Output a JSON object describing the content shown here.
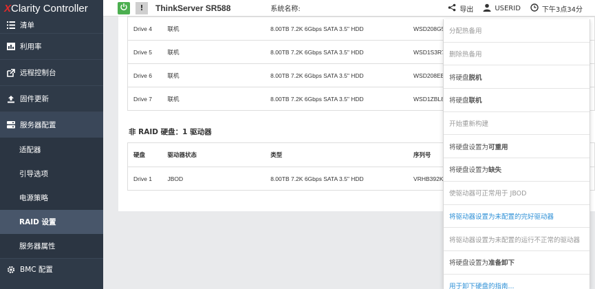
{
  "app": {
    "brand_x": "X",
    "brand_rest": "Clarity",
    "brand_suffix": " Controller"
  },
  "header": {
    "warn_symbol": "!",
    "server_name": "ThinkServer SR588",
    "system_name_label": "系统名称:",
    "export_label": "导出",
    "user_label": "USERID",
    "time_label": "下午3点34分",
    "colors": {
      "power": "#4caf50"
    }
  },
  "sidebar": {
    "items": [
      {
        "label": "清单",
        "icon": "list-icon"
      },
      {
        "label": "利用率",
        "icon": "bar-chart-icon"
      },
      {
        "label": "远程控制台",
        "icon": "external-link-icon"
      },
      {
        "label": "固件更新",
        "icon": "upload-icon"
      },
      {
        "label": "服务器配置",
        "icon": "server-icon"
      }
    ],
    "sub_items": [
      {
        "label": "适配器"
      },
      {
        "label": "引导选项"
      },
      {
        "label": "电源策略"
      },
      {
        "label": "RAID 设置"
      },
      {
        "label": "服务器属性"
      }
    ],
    "bottom_item": {
      "label": "BMC 配置",
      "icon": "gear-icon"
    }
  },
  "raid_table": {
    "rows": [
      {
        "drive": "Drive 4",
        "state": "联机",
        "type": "8.00TB 7.2K 6Gbps SATA 3.5\" HDD",
        "serial": "WSD208G5"
      },
      {
        "drive": "Drive 5",
        "state": "联机",
        "type": "8.00TB 7.2K 6Gbps SATA 3.5\" HDD",
        "serial": "WSD1S3R7"
      },
      {
        "drive": "Drive 6",
        "state": "联机",
        "type": "8.00TB 7.2K 6Gbps SATA 3.5\" HDD",
        "serial": "WSD208EB"
      },
      {
        "drive": "Drive 7",
        "state": "联机",
        "type": "8.00TB 7.2K 6Gbps SATA 3.5\" HDD",
        "serial": "WSD1ZBL8"
      }
    ]
  },
  "non_raid": {
    "title": "非 RAID 硬盘：1 驱动器",
    "headers": {
      "drive": "硬盘",
      "state": "驱动器状态",
      "type": "类型",
      "serial": "序列号"
    },
    "rows": [
      {
        "drive": "Drive 1",
        "state": "JBOD",
        "type": "8.00TB 7.2K 6Gbps SATA 3.5\" HDD",
        "serial": "VRHB392K"
      }
    ]
  },
  "menu": {
    "items": [
      {
        "label": "分配热备用",
        "state": "disabled"
      },
      {
        "label": "删除热备用",
        "state": "disabled"
      },
      {
        "label": "将硬盘",
        "bold": "脱机",
        "state": "enabled"
      },
      {
        "label": "将硬盘",
        "bold": "联机",
        "state": "enabled"
      },
      {
        "label": "开始重新构建",
        "state": "disabled"
      },
      {
        "label": "将硬盘设置为",
        "bold": "可重用",
        "state": "enabled"
      },
      {
        "label": "将硬盘设置为",
        "bold": "缺失",
        "state": "enabled"
      },
      {
        "label": "使驱动器可正常用于 JBOD",
        "state": "disabled"
      },
      {
        "label": "将驱动器设置为未配置的完好驱动器",
        "state": "link"
      },
      {
        "label": "将驱动器设置为未配置的运行不正常的驱动器",
        "state": "disabled"
      },
      {
        "label": "将硬盘设置为",
        "bold": "准备卸下",
        "state": "enabled"
      },
      {
        "label": "用于卸下硬盘的指南...",
        "state": "link"
      }
    ],
    "colors": {
      "link": "#2c8fd6",
      "disabled": "#999999",
      "enabled": "#555555"
    }
  }
}
